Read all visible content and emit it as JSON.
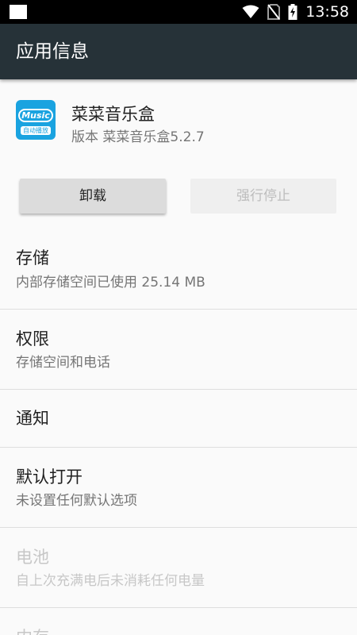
{
  "status_bar": {
    "time": "13:58"
  },
  "app_bar": {
    "title": "应用信息"
  },
  "app": {
    "name": "菜菜音乐盒",
    "version": "版本 菜菜音乐盒5.2.7",
    "icon_text": "Music",
    "icon_subtext": "自动播放"
  },
  "buttons": {
    "uninstall": "卸载",
    "force_stop": "强行停止"
  },
  "settings": [
    {
      "title": "存储",
      "subtitle": "内部存储空间已使用 25.14 MB"
    },
    {
      "title": "权限",
      "subtitle": "存储空间和电话"
    },
    {
      "title": "通知"
    },
    {
      "title": "默认打开",
      "subtitle": "未设置任何默认选项"
    },
    {
      "title": "电池",
      "subtitle": "自上次充满电后未消耗任何电量"
    },
    {
      "title": "内存"
    }
  ]
}
